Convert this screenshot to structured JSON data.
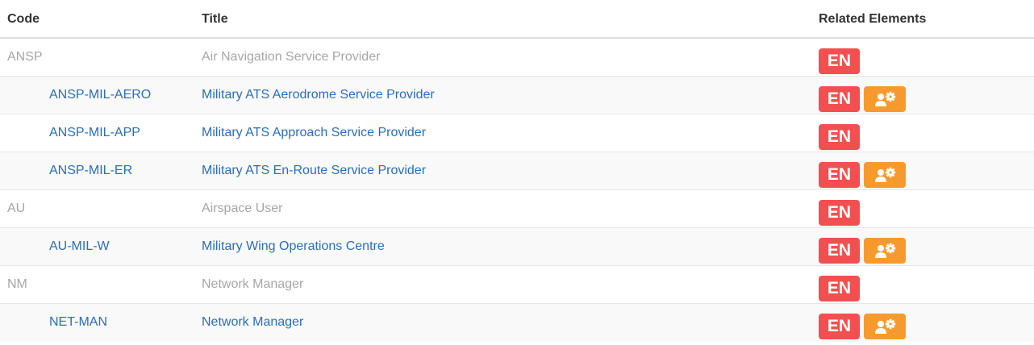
{
  "columns": {
    "code": "Code",
    "title": "Title",
    "related": "Related Elements"
  },
  "colors": {
    "en_badge": "#f25050",
    "role_badge": "#f79a2e",
    "link": "#2a6ebb",
    "muted": "#a6a6a6"
  },
  "rows": [
    {
      "code": "ANSP",
      "title": "Air Navigation Service Provider",
      "level": "parent",
      "badges": [
        "EN"
      ]
    },
    {
      "code": "ANSP-MIL-AERO",
      "title": "Military ATS Aerodrome Service Provider",
      "level": "child",
      "badges": [
        "EN",
        "user-gear-icon"
      ]
    },
    {
      "code": "ANSP-MIL-APP",
      "title": "Military ATS Approach Service Provider",
      "level": "child",
      "badges": [
        "EN"
      ]
    },
    {
      "code": "ANSP-MIL-ER",
      "title": "Military ATS En-Route Service Provider",
      "level": "child",
      "badges": [
        "EN",
        "user-gear-icon"
      ]
    },
    {
      "code": "AU",
      "title": "Airspace User",
      "level": "parent",
      "badges": [
        "EN"
      ]
    },
    {
      "code": "AU-MIL-W",
      "title": "Military Wing Operations Centre",
      "level": "child",
      "badges": [
        "EN",
        "user-gear-icon"
      ]
    },
    {
      "code": "NM",
      "title": "Network Manager",
      "level": "parent",
      "badges": [
        "EN"
      ]
    },
    {
      "code": "NET-MAN",
      "title": "Network Manager",
      "level": "child",
      "badges": [
        "EN",
        "user-gear-icon"
      ]
    }
  ]
}
